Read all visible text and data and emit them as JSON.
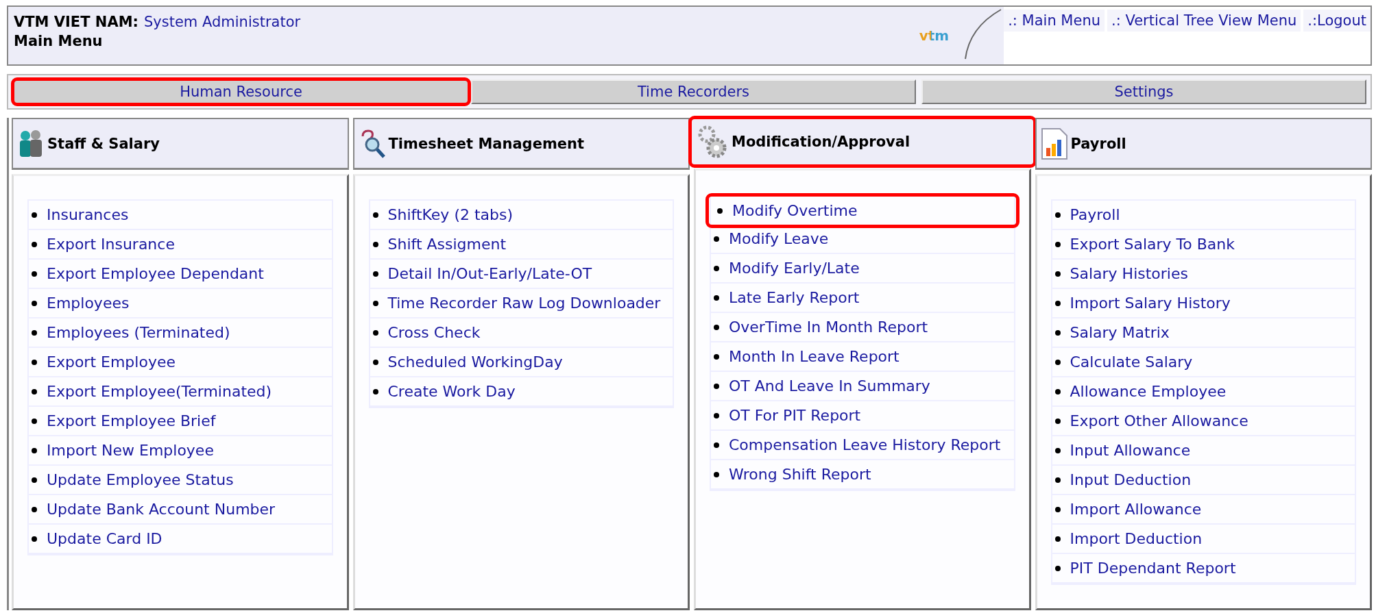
{
  "header": {
    "company": "VTM VIET NAM:",
    "user": "System Administrator",
    "page_title": "Main Menu",
    "logo": "vtm",
    "links": [
      ".: Main Menu",
      ".: Vertical Tree View Menu",
      ".:Logout"
    ]
  },
  "tabs": [
    {
      "label": "Human Resource",
      "highlighted": true
    },
    {
      "label": "Time Recorders",
      "highlighted": false
    },
    {
      "label": "Settings",
      "highlighted": false
    }
  ],
  "sections": [
    {
      "title": "Staff & Salary",
      "kind": "staff",
      "highlighted": false,
      "items": [
        {
          "label": "Insurances",
          "highlighted": false
        },
        {
          "label": "Export Insurance",
          "highlighted": false
        },
        {
          "label": "Export Employee Dependant",
          "highlighted": false
        },
        {
          "label": "Employees",
          "highlighted": false
        },
        {
          "label": "Employees (Terminated)",
          "highlighted": false
        },
        {
          "label": "Export Employee",
          "highlighted": false
        },
        {
          "label": "Export Employee(Terminated)",
          "highlighted": false
        },
        {
          "label": "Export Employee Brief",
          "highlighted": false
        },
        {
          "label": "Import New Employee",
          "highlighted": false
        },
        {
          "label": "Update Employee Status",
          "highlighted": false
        },
        {
          "label": "Update Bank Account Number",
          "highlighted": false
        },
        {
          "label": "Update Card ID",
          "highlighted": false
        }
      ]
    },
    {
      "title": "Timesheet Management",
      "kind": "timesheet",
      "highlighted": false,
      "items": [
        {
          "label": "ShiftKey (2 tabs)",
          "highlighted": false
        },
        {
          "label": "Shift Assigment",
          "highlighted": false
        },
        {
          "label": "Detail In/Out-Early/Late-OT",
          "highlighted": false
        },
        {
          "label": "Time Recorder Raw Log Downloader",
          "highlighted": false
        },
        {
          "label": "Cross Check",
          "highlighted": false
        },
        {
          "label": "Scheduled WorkingDay",
          "highlighted": false
        },
        {
          "label": "Create Work Day",
          "highlighted": false
        }
      ]
    },
    {
      "title": "Modification/Approval",
      "kind": "modification",
      "highlighted": true,
      "items": [
        {
          "label": "Modify Overtime",
          "highlighted": true
        },
        {
          "label": "Modify Leave",
          "highlighted": false
        },
        {
          "label": "Modify Early/Late",
          "highlighted": false
        },
        {
          "label": "Late Early Report",
          "highlighted": false
        },
        {
          "label": "OverTime In Month Report",
          "highlighted": false
        },
        {
          "label": "Month In Leave Report",
          "highlighted": false
        },
        {
          "label": "OT And Leave In Summary",
          "highlighted": false
        },
        {
          "label": "OT For PIT Report",
          "highlighted": false
        },
        {
          "label": "Compensation Leave History Report",
          "highlighted": false
        },
        {
          "label": "Wrong Shift Report",
          "highlighted": false
        }
      ]
    },
    {
      "title": "Payroll",
      "kind": "payroll",
      "highlighted": false,
      "items": [
        {
          "label": "Payroll",
          "highlighted": false
        },
        {
          "label": "Export Salary To Bank",
          "highlighted": false
        },
        {
          "label": "Salary Histories",
          "highlighted": false
        },
        {
          "label": "Import Salary History",
          "highlighted": false
        },
        {
          "label": "Salary Matrix",
          "highlighted": false
        },
        {
          "label": "Calculate Salary",
          "highlighted": false
        },
        {
          "label": "Allowance Employee",
          "highlighted": false
        },
        {
          "label": "Export Other Allowance",
          "highlighted": false
        },
        {
          "label": "Input Allowance",
          "highlighted": false
        },
        {
          "label": "Input Deduction",
          "highlighted": false
        },
        {
          "label": "Import Allowance",
          "highlighted": false
        },
        {
          "label": "Import Deduction",
          "highlighted": false
        },
        {
          "label": "PIT Dependant Report",
          "highlighted": false
        }
      ]
    }
  ]
}
